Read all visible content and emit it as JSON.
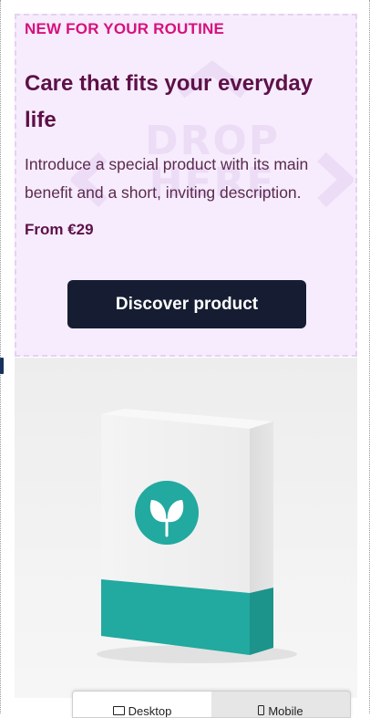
{
  "hero": {
    "eyebrow": "NEW FOR YOUR ROUTINE",
    "headline": "Care that fits your everyday life",
    "description": "Introduce a special product with its main benefit and a short, inviting description.",
    "price": "From €29",
    "cta_label": "Discover product",
    "background_color": "#f6ecfd",
    "accent_color": "#d8107e",
    "heading_color": "#5e1048",
    "button_color": "#161d33",
    "watermark_icon": "drop-here-arrows-icon"
  },
  "product_image": {
    "icon": "leaf-sprout-icon",
    "box_accent_color": "#22a9a0"
  },
  "view_toggle": {
    "options": [
      {
        "label": "Desktop",
        "icon": "desktop-icon",
        "active": true
      },
      {
        "label": "Mobile",
        "icon": "mobile-icon",
        "active": false
      }
    ]
  }
}
